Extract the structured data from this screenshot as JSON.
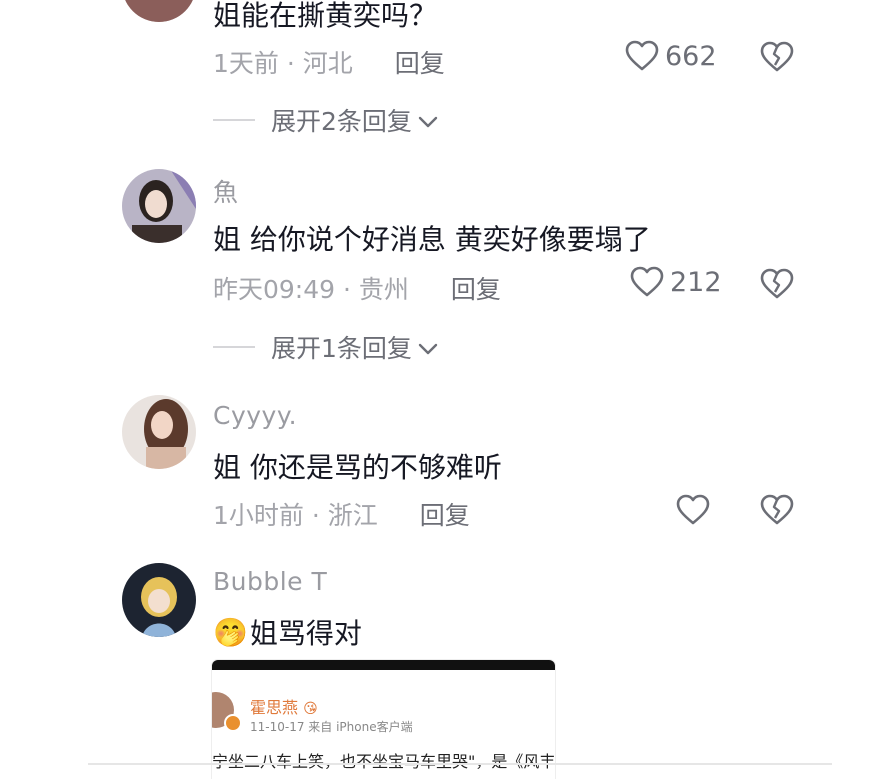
{
  "comments": [
    {
      "username": "",
      "text": "姐能在撕黄奕吗？",
      "meta": "1天前 · 河北",
      "reply_label": "回复",
      "likes": "662",
      "expand_label": "展开2条回复"
    },
    {
      "username": "魚",
      "text": "姐 给你说个好消息 黄奕好像要塌了",
      "meta": "昨天09:49 · 贵州",
      "reply_label": "回复",
      "likes": "212",
      "expand_label": "展开1条回复"
    },
    {
      "username": "Cyyyy.",
      "text": "姐 你还是骂的不够难听",
      "meta": "1小时前 · 浙江",
      "reply_label": "回复",
      "likes": ""
    },
    {
      "username": "Bubble T",
      "text": "姐骂得对",
      "emoji": "🤭"
    }
  ],
  "image_card": {
    "name": "霍思燕",
    "badge": "😘",
    "date_source": "11-10-17  来自 iPhone客户端",
    "body": "宁坐二八车上笑，也不坐宝马车里哭\"，是《风丰"
  },
  "colors": {
    "text": "#161823",
    "secondary": "#9a9ba1",
    "icon": "#6c6e76"
  },
  "icons": [
    "heart-outline",
    "broken-heart",
    "chevron-down"
  ]
}
